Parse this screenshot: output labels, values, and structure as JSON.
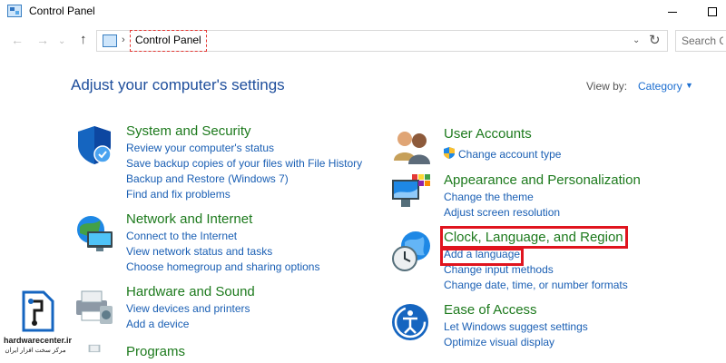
{
  "window": {
    "title": "Control Panel"
  },
  "address_bar": {
    "crumb": "Control Panel",
    "search_placeholder": "Search C"
  },
  "header": {
    "heading": "Adjust your computer's settings",
    "view_by_label": "View by:",
    "view_by_value": "Category"
  },
  "categories_left": [
    {
      "title": "System and Security",
      "icon": "shield-icon",
      "links": [
        "Review your computer's status",
        "Save backup copies of your files with File History",
        "Backup and Restore (Windows 7)",
        "Find and fix problems"
      ]
    },
    {
      "title": "Network and Internet",
      "icon": "network-globe-icon",
      "links": [
        "Connect to the Internet",
        "View network status and tasks",
        "Choose homegroup and sharing options"
      ]
    },
    {
      "title": "Hardware and Sound",
      "icon": "printer-icon",
      "links": [
        "View devices and printers",
        "Add a device"
      ]
    },
    {
      "title": "Programs",
      "icon": "programs-icon",
      "links": []
    }
  ],
  "categories_right": [
    {
      "title": "User Accounts",
      "icon": "users-icon",
      "links": [
        "Change account type"
      ]
    },
    {
      "title": "Appearance and Personalization",
      "icon": "monitor-palette-icon",
      "links": [
        "Change the theme",
        "Adjust screen resolution"
      ]
    },
    {
      "title": "Clock, Language, and Region",
      "icon": "clock-globe-icon",
      "links": [
        "Add a language",
        "Change input methods",
        "Change date, time, or number formats"
      ]
    },
    {
      "title": "Ease of Access",
      "icon": "ease-of-access-icon",
      "links": [
        "Let Windows suggest settings",
        "Optimize visual display"
      ]
    }
  ],
  "watermark": {
    "text": "hardwarecenter.ir",
    "subtext": "مرکز سخت افزار ایران"
  },
  "colors": {
    "category_title": "#1d7a1d",
    "link": "#1a5fb4",
    "heading": "#1e4e9c",
    "highlight": "#e0141e"
  }
}
